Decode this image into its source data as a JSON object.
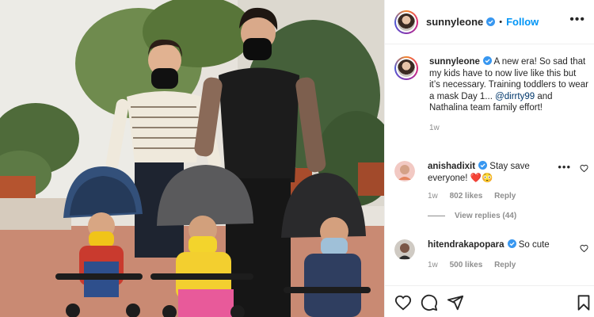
{
  "post": {
    "author": "sunnyleone",
    "verified": true,
    "separator": "•",
    "follow_label": "Follow",
    "more_label": "•••",
    "caption_text": " A new era! So sad that my kids have to now live like this but it’s necessary. Training toddlers to wear a mask Day 1...",
    "caption_mention": "@dirrty99",
    "caption_tail": " and Nathalina team family effort!",
    "caption_time": "1w"
  },
  "comments": [
    {
      "username": "anishadixit",
      "verified": true,
      "text": " Stay save everyone! ❤️😳",
      "time": "1w",
      "likes": "802 likes",
      "reply_label": "Reply",
      "view_replies": "View replies (44)",
      "more_label": "•••"
    },
    {
      "username": "hitendrakapopara",
      "verified": true,
      "text": " So cute",
      "time": "1w",
      "likes": "500 likes",
      "reply_label": "Reply"
    }
  ],
  "actions": [
    "heart-icon",
    "comment-icon",
    "share-icon",
    "bookmark-icon"
  ],
  "colors": {
    "accent": "#0095f6",
    "verified": "#3897f0",
    "mention": "#00376b",
    "muted": "#8e8e8e",
    "text": "#262626"
  }
}
